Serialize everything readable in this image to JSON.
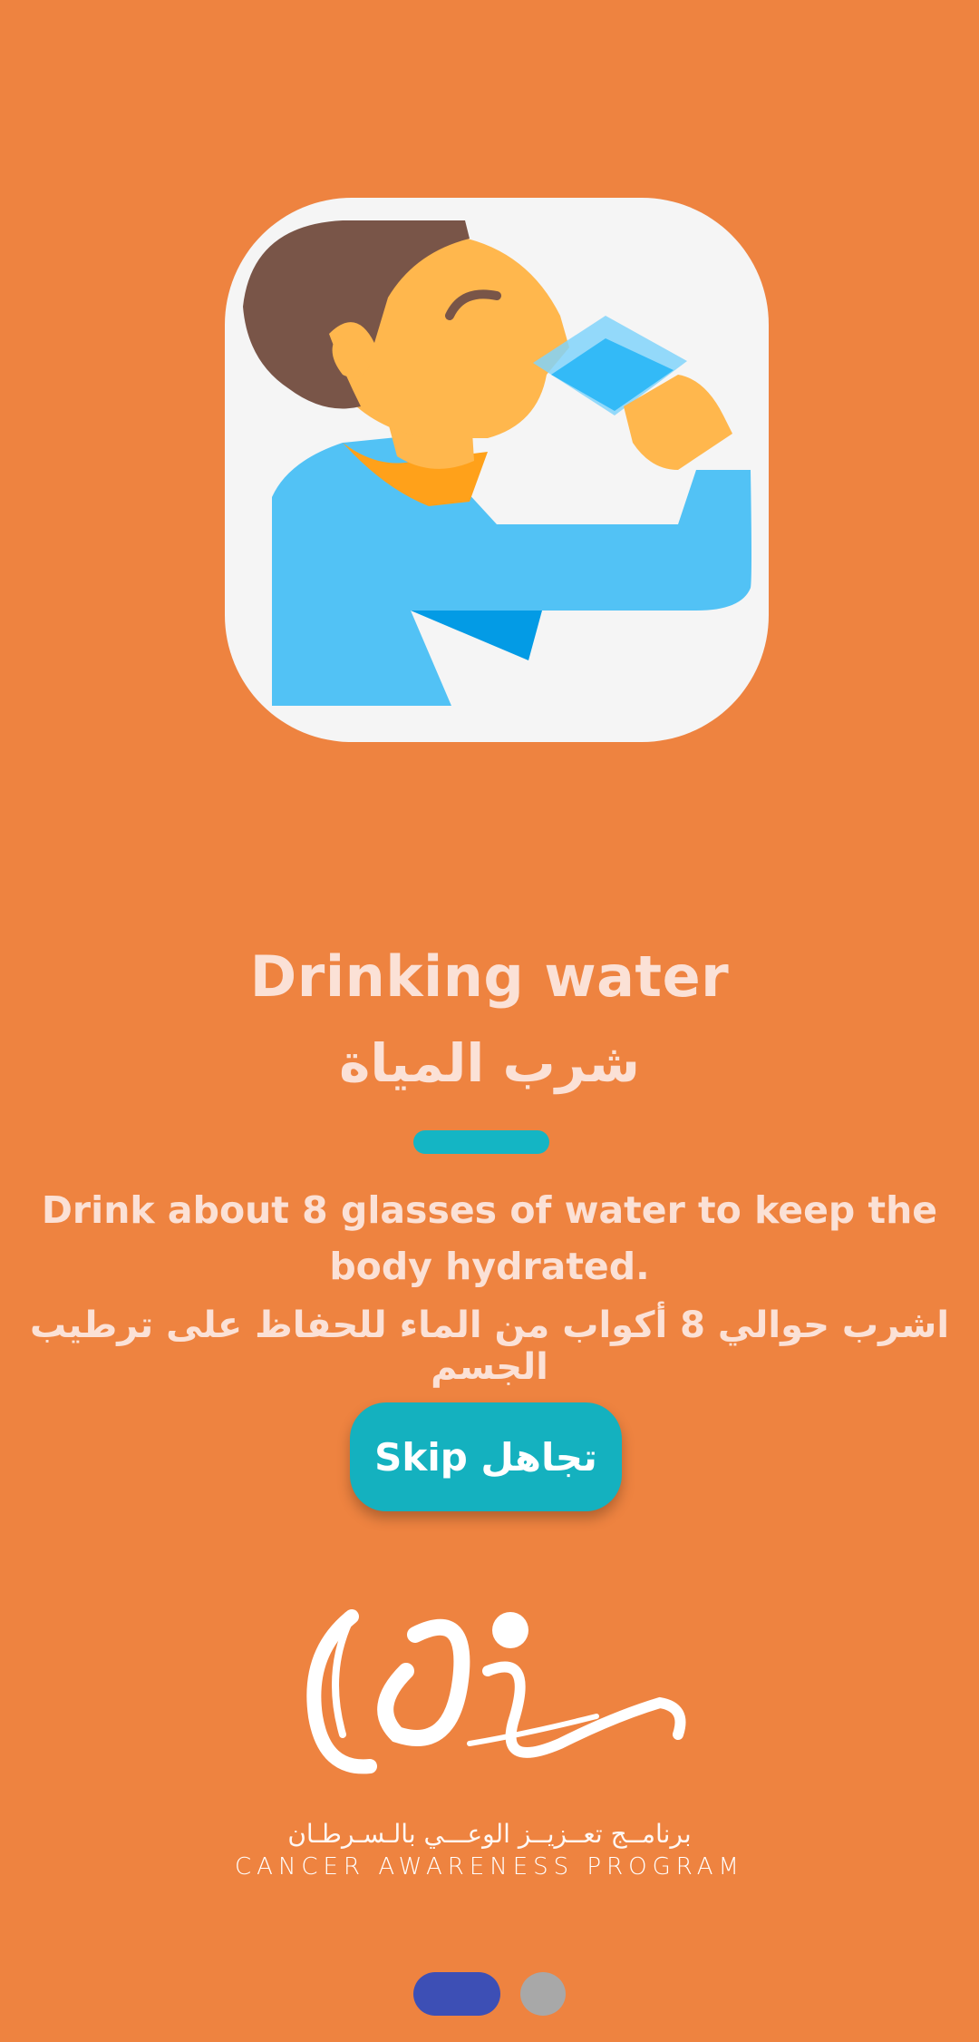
{
  "onboarding": {
    "title_en": "Drinking water",
    "title_ar": "شرب المياة",
    "description_en": "Drink about 8 glasses of water to keep the body hydrated.",
    "description_ar": "اشرب حوالي 8 أكواب من الماء للحفاظ على ترطيب الجسم",
    "skip_label": "Skip تجاهل",
    "illustration_icon": "person-drinking-water-icon"
  },
  "branding": {
    "logo_icon": "cancer-awareness-program-logo",
    "name_ar": "برنامــج تعــزيــز الوعـــي بالـسـرطـان",
    "name_en": "CANCER AWARENESS PROGRAM"
  },
  "page_indicator": {
    "current": 1,
    "total": 2
  },
  "colors": {
    "background": "#EE8340",
    "accent": "#14B1BF",
    "text": "#FBE1D6",
    "active_dot": "#3D4FB5",
    "inactive_dot": "#A8A8A8"
  }
}
